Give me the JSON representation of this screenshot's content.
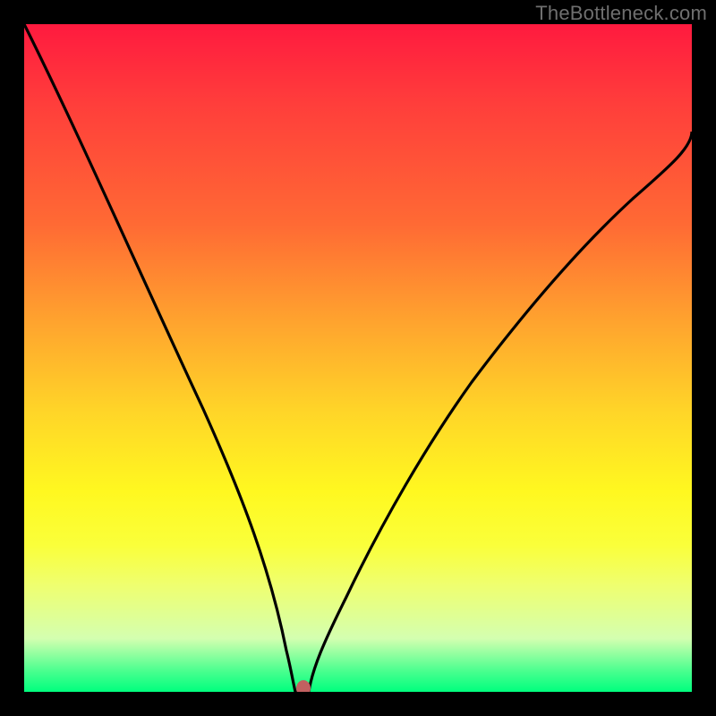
{
  "watermark": "TheBottleneck.com",
  "chart_data": {
    "type": "line",
    "title": "",
    "xlabel": "",
    "ylabel": "",
    "xlim": [
      0,
      100
    ],
    "ylim": [
      0,
      100
    ],
    "x": [
      0,
      5,
      10,
      15,
      20,
      25,
      30,
      33,
      36,
      38,
      39.5,
      41.5,
      45,
      50,
      55,
      60,
      65,
      70,
      75,
      80,
      85,
      90,
      95,
      100
    ],
    "values": [
      100,
      89,
      77,
      65,
      53,
      41,
      29,
      20,
      11,
      4,
      0,
      0,
      10,
      25,
      38,
      49,
      58,
      65,
      71,
      76,
      79.5,
      82.5,
      85,
      87
    ],
    "marker": {
      "x": 41.5,
      "y": 0,
      "color": "#c26060"
    },
    "gradient_stops": [
      {
        "pos": 0,
        "color": "#ff1a3f"
      },
      {
        "pos": 0.5,
        "color": "#ffd528"
      },
      {
        "pos": 0.78,
        "color": "#faff3a"
      },
      {
        "pos": 1.0,
        "color": "#00ff7e"
      }
    ]
  }
}
